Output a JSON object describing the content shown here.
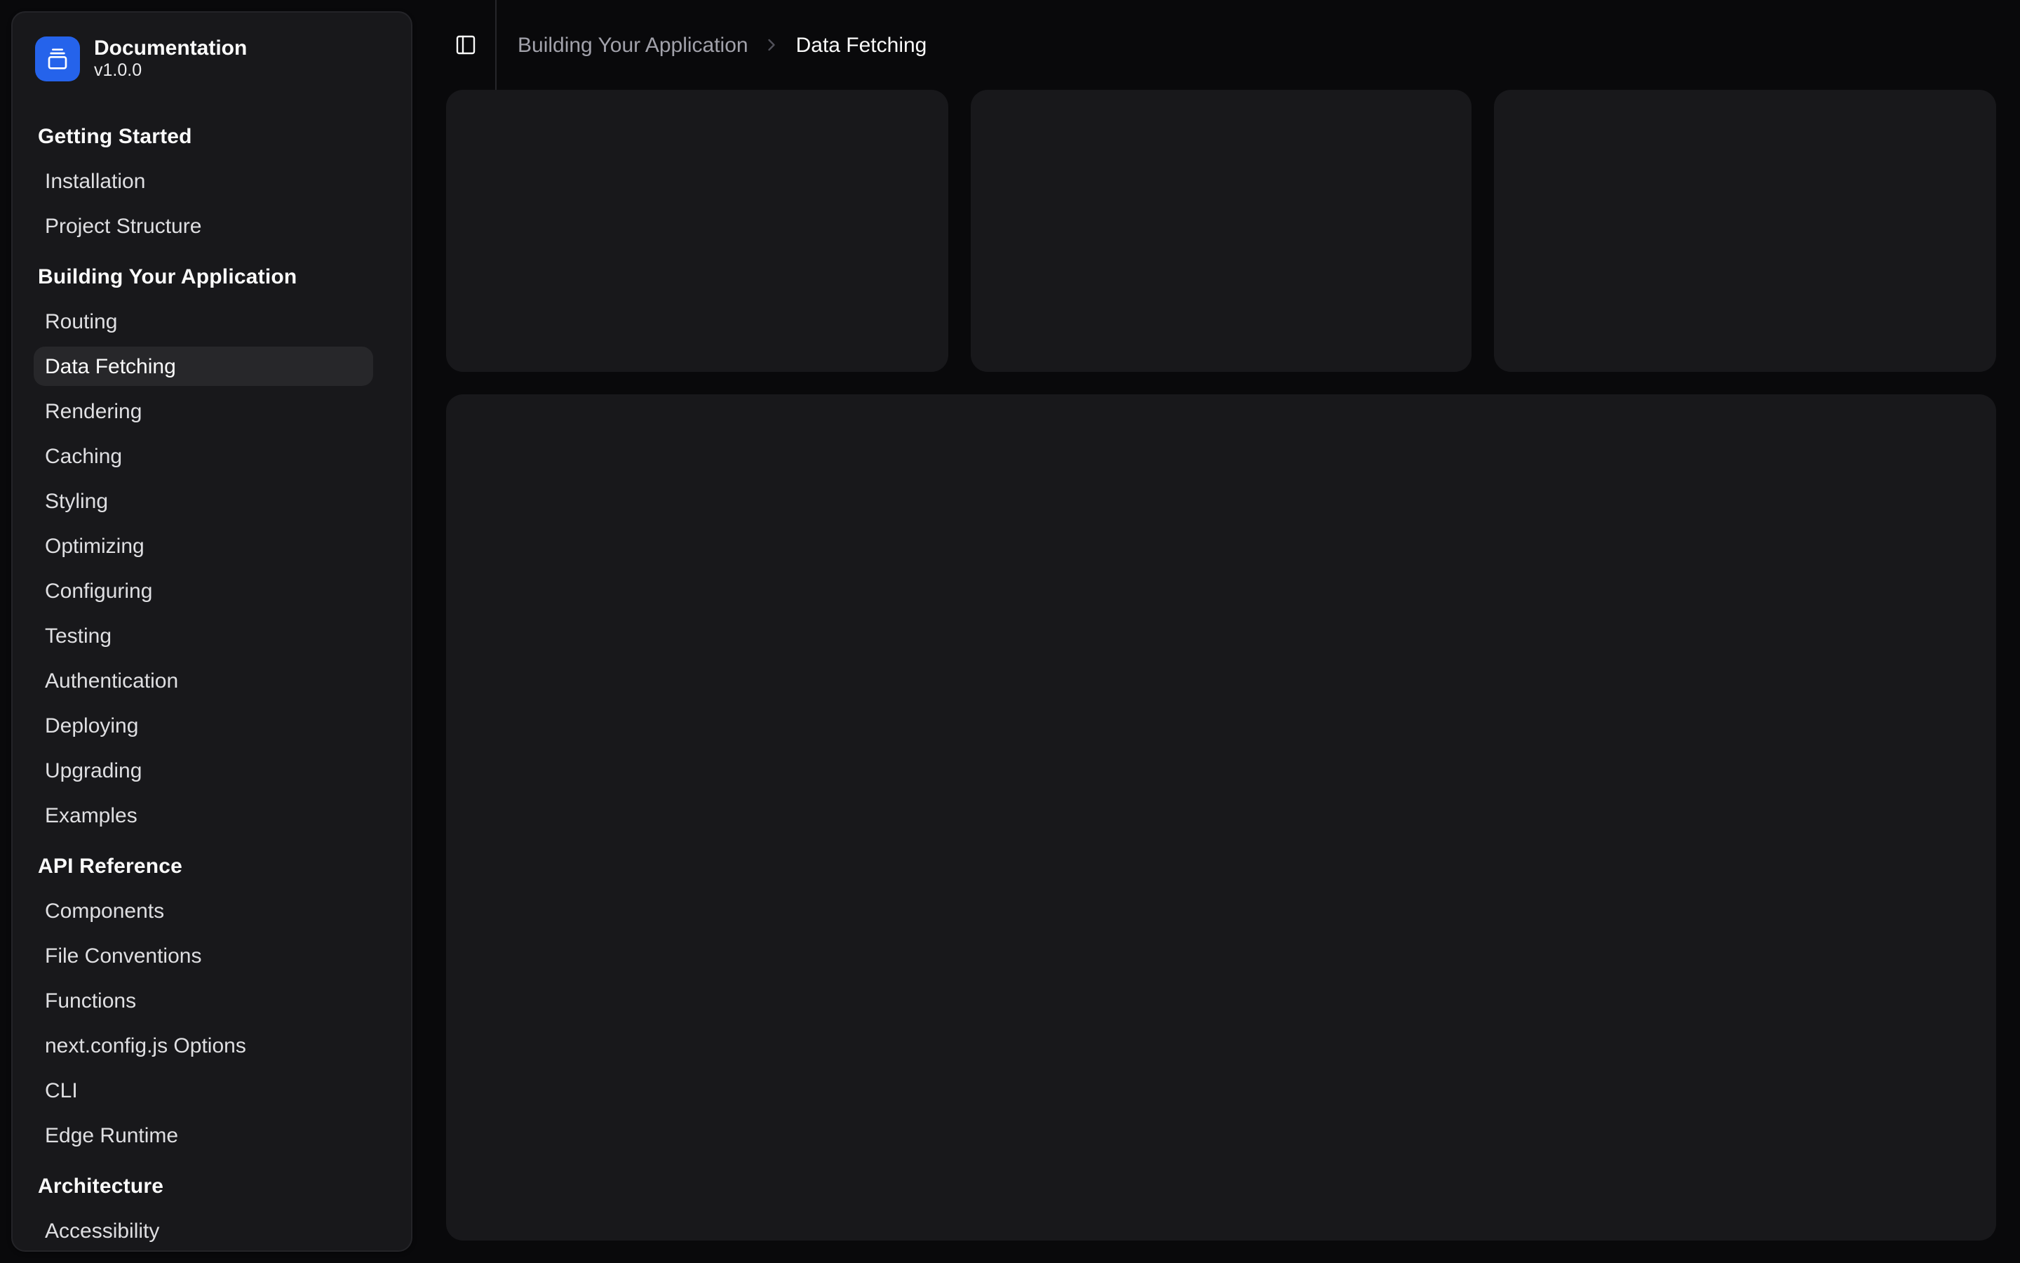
{
  "sidebar": {
    "header": {
      "title": "Documentation",
      "version": "v1.0.0",
      "logo_icon": "gallery-vertical-end-icon"
    },
    "groups": [
      {
        "label": "Getting Started",
        "items": [
          {
            "label": "Installation",
            "active": false
          },
          {
            "label": "Project Structure",
            "active": false
          }
        ]
      },
      {
        "label": "Building Your Application",
        "items": [
          {
            "label": "Routing",
            "active": false
          },
          {
            "label": "Data Fetching",
            "active": true
          },
          {
            "label": "Rendering",
            "active": false
          },
          {
            "label": "Caching",
            "active": false
          },
          {
            "label": "Styling",
            "active": false
          },
          {
            "label": "Optimizing",
            "active": false
          },
          {
            "label": "Configuring",
            "active": false
          },
          {
            "label": "Testing",
            "active": false
          },
          {
            "label": "Authentication",
            "active": false
          },
          {
            "label": "Deploying",
            "active": false
          },
          {
            "label": "Upgrading",
            "active": false
          },
          {
            "label": "Examples",
            "active": false
          }
        ]
      },
      {
        "label": "API Reference",
        "items": [
          {
            "label": "Components",
            "active": false
          },
          {
            "label": "File Conventions",
            "active": false
          },
          {
            "label": "Functions",
            "active": false
          },
          {
            "label": "next.config.js Options",
            "active": false
          },
          {
            "label": "CLI",
            "active": false
          },
          {
            "label": "Edge Runtime",
            "active": false
          }
        ]
      },
      {
        "label": "Architecture",
        "items": [
          {
            "label": "Accessibility",
            "active": false
          }
        ]
      }
    ]
  },
  "header": {
    "toggle_icon": "panel-left-icon",
    "breadcrumb": {
      "parent": "Building Your Application",
      "separator_icon": "chevron-right-icon",
      "current": "Data Fetching"
    }
  },
  "main": {
    "placeholder_cards": 3,
    "big_placeholder": 1
  },
  "colors": {
    "page_bg": "#09090b",
    "panel_bg": "#18181b",
    "panel_border": "#242428",
    "active_item_bg": "#27272a",
    "logo_bg": "#2563eb",
    "text_primary": "#fafafa",
    "text_muted": "#a1a1aa"
  }
}
